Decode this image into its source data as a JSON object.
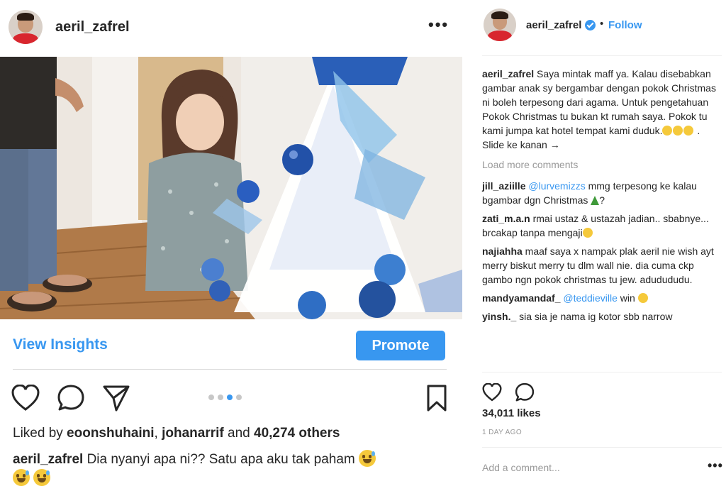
{
  "post": {
    "username": "aeril_zafrel",
    "more_glyph": "•••"
  },
  "insights": {
    "view_label": "View Insights",
    "promote_label": "Promote"
  },
  "carousel": {
    "count": 4,
    "active_index": 2
  },
  "icons": {
    "like": "heart-icon",
    "comment": "speech-bubble-icon",
    "share": "paper-plane-icon",
    "save": "bookmark-icon",
    "verified": "verified-badge-icon",
    "more": "ellipsis-icon"
  },
  "liked_by": {
    "prefix": "Liked by ",
    "user1": "eoonshuhaini",
    "sep": ", ",
    "user2": "johanarrif",
    "and": " and ",
    "others": "40,274 others"
  },
  "caption": {
    "username": "aeril_zafrel",
    "text": " Dia nyanyi apa ni?? Satu apa aku tak paham "
  },
  "right": {
    "username": "aeril_zafrel",
    "dot": "•",
    "follow": "Follow",
    "owner_comment": {
      "username": "aeril_zafrel",
      "text": " Saya mintak maff ya. Kalau disebabkan gambar anak sy bergambar dengan pokok Christmas ni boleh terpesong dari agama. Untuk pengetahuan Pokok Christmas tu bukan kt rumah saya. Pokok tu kami jumpa kat hotel tempat kami duduk.",
      "suffix": " . Slide ke kanan →"
    },
    "load_more": "Load more comments",
    "comments": [
      {
        "username": "jill_aziille",
        "mention": "@lurvemizzs",
        "text": " mmg terpesong ke kalau bgambar dgn Christmas ",
        "suffix": "?"
      },
      {
        "username": "zati_m.a.n",
        "text": " rmai ustaz & ustazah jadian.. sbabnye... brcakap tanpa mengaji"
      },
      {
        "username": "najiahha",
        "text": " maaf saya x nampak plak aeril nie wish ayt merry biskut merry tu dlm wall nie. dia cuma ckp gambo ngn pokok christmas tu jew. adudududu."
      },
      {
        "username": "mandyamandaf_",
        "mention": "@teddieville",
        "text": " win "
      },
      {
        "username": "yinsh._",
        "text": " sia sia je nama ig kotor sbb narrow"
      }
    ],
    "likes": "34,011 likes",
    "time": "1 DAY AGO",
    "add_comment": "Add a comment...",
    "more_glyph": "•••"
  },
  "colors": {
    "accent": "#3897f0",
    "text": "#262626",
    "muted": "#999999",
    "divider": "#dbdbdb"
  }
}
